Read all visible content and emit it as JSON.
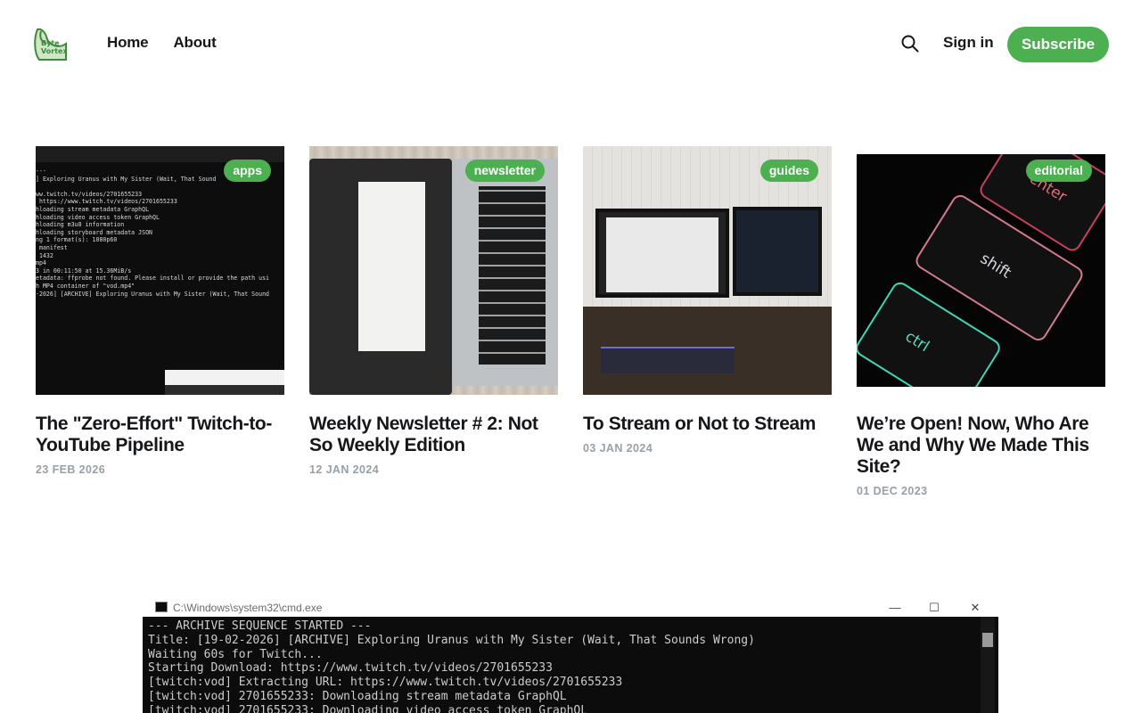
{
  "header": {
    "logo_line1": "Byte",
    "logo_line2": "Vortex",
    "nav": [
      "Home",
      "About"
    ],
    "signin_label": "Sign in",
    "subscribe_label": "Subscribe",
    "icons": {
      "search": "search-icon"
    }
  },
  "brand_color": "#4caf50",
  "posts": [
    {
      "tag": "apps",
      "title": "The \"Zero-Effort\" Twitch-to-YouTube Pipeline",
      "date": "23 FEB 2026"
    },
    {
      "tag": "newsletter",
      "title": "Weekly Newsletter # 2: Not So Weekly Edition",
      "date": "12 JAN 2024"
    },
    {
      "tag": "guides",
      "title": "To Stream or Not to Stream",
      "date": "03 JAN 2024"
    },
    {
      "tag": "editorial",
      "title": "We’re Open! Now, Who Are We and Why We Made This Site?",
      "date": "01 DEC 2023"
    }
  ],
  "thumb_terminal_lines": "---\n] Exploring Uranus with My Sister (Wait, That Sound\n\nww.twitch.tv/videos/2701655233\n https://www.twitch.tv/videos/2701655233\nhloading stream metadata GraphQL\nhloading video access token GraphQL\nhloading m3u8 information\nhloading storyboard metadata JSON\nng 1 format(s): 1080p60\n manifest\n 1432\nmp4\n3 in 00:11:50 at 15.36MiB/s\netadata: ffprobe not found. Please install or provide the path usi\nh MP4 container of \"vod.mp4\"\n-2026] [ARCHIVE] Exploring Uranus with My Sister (Wait, That Sound",
  "thumb_keys": {
    "enter": "enter",
    "shift": "shift",
    "ctrl": "ctrl"
  },
  "cmd": {
    "title": "C:\\Windows\\system32\\cmd.exe",
    "lines": "--- ARCHIVE SEQUENCE STARTED ---\nTitle: [19-02-2026] [ARCHIVE] Exploring Uranus with My Sister (Wait, That Sounds Wrong)\nWaiting 60s for Twitch...\nStarting Download: https://www.twitch.tv/videos/2701655233\n[twitch:vod] Extracting URL: https://www.twitch.tv/videos/2701655233\n[twitch:vod] 2701655233: Downloading stream metadata GraphQL\n[twitch:vod] 2701655233: Downloading video access token GraphQL"
  }
}
